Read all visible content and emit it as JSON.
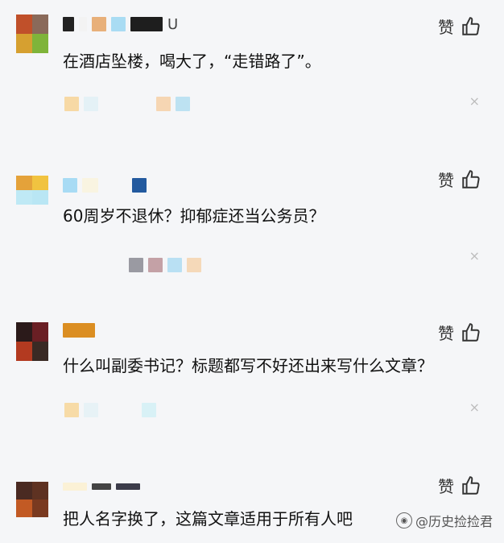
{
  "like_label": "赞",
  "close_symbol": "×",
  "watermark": "@历史捡捡君",
  "comments": [
    {
      "text": "在酒店坠楼，喝大了，“走错路了”。"
    },
    {
      "text": "60周岁不退休？抑郁症还当公务员？"
    },
    {
      "text": "什么叫副委书记？标题都写不好还出来写什么文章？"
    },
    {
      "text": "把人名字换了，这篇文章适用于所有人吧"
    }
  ],
  "colors": {
    "background": "#f5f6f8",
    "text": "#111111"
  }
}
